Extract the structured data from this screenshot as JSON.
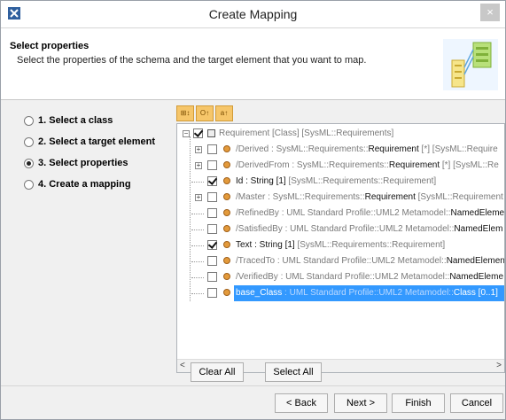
{
  "window": {
    "title": "Create Mapping",
    "close_glyph": "×",
    "app_icon": "app-icon"
  },
  "header": {
    "title": "Select properties",
    "description": "Select the properties of the schema and the target element that you want to map.",
    "art_icon": "mapping-wizard-illustration"
  },
  "steps": [
    {
      "label": "1. Select a class",
      "selected": false
    },
    {
      "label": "2. Select a target element",
      "selected": false
    },
    {
      "label": "3. Select properties",
      "selected": true
    },
    {
      "label": "4. Create a mapping",
      "selected": false
    }
  ],
  "toolbar": {
    "buttons": [
      {
        "name": "expand-all-icon",
        "glyph": "⊞↕"
      },
      {
        "name": "sort-icon",
        "glyph": "O↑"
      },
      {
        "name": "sort-alpha-icon",
        "glyph": "a↑"
      }
    ]
  },
  "tree": {
    "root": {
      "label": "Requirement [Class] [SysML::Requirements]",
      "checked": true
    },
    "items": [
      {
        "name_part": "/Derived",
        "rest_gray": " : SysML::Requirements::",
        "rest_dark": "Requirement",
        "tail": " [*] [SysML::Require",
        "checked": false,
        "expandable": true
      },
      {
        "name_part": "/DerivedFrom",
        "rest_gray": " : SysML::Requirements::",
        "rest_dark": "Requirement",
        "tail": " [*] [SysML::Re",
        "checked": false,
        "expandable": true
      },
      {
        "name_part": "Id",
        "rest_gray": "",
        "rest_dark": " : String [1]",
        "tail": " [SysML::Requirements::Requirement]",
        "checked": true,
        "expandable": false
      },
      {
        "name_part": "/Master",
        "rest_gray": " : SysML::Requirements::",
        "rest_dark": "Requirement",
        "tail": " [SysML::Requirement",
        "checked": false,
        "expandable": true
      },
      {
        "name_part": "/RefinedBy",
        "rest_gray": " : UML Standard Profile::UML2 Metamodel::",
        "rest_dark": "NamedElemen",
        "tail": "",
        "checked": false,
        "expandable": false
      },
      {
        "name_part": "/SatisfiedBy",
        "rest_gray": " : UML Standard Profile::UML2 Metamodel::",
        "rest_dark": "NamedElem",
        "tail": "",
        "checked": false,
        "expandable": false
      },
      {
        "name_part": "Text",
        "rest_gray": "",
        "rest_dark": " : String [1]",
        "tail": " [SysML::Requirements::Requirement]",
        "checked": true,
        "expandable": false
      },
      {
        "name_part": "/TracedTo",
        "rest_gray": " : UML Standard Profile::UML2 Metamodel::",
        "rest_dark": "NamedElemen",
        "tail": "",
        "checked": false,
        "expandable": false
      },
      {
        "name_part": "/VerifiedBy",
        "rest_gray": " : UML Standard Profile::UML2 Metamodel::",
        "rest_dark": "NamedEleme",
        "tail": "",
        "checked": false,
        "expandable": false
      },
      {
        "name_part": "base_Class",
        "rest_gray": " : UML Standard Profile::UML2 Metamodel::",
        "rest_dark": "Class",
        "tail": " [0..1]",
        "checked": false,
        "expandable": false,
        "selected": true
      }
    ]
  },
  "tree_buttons": {
    "clear_all": "Clear All",
    "select_all": "Select All"
  },
  "footer": {
    "back": "< Back",
    "next": "Next >",
    "finish": "Finish",
    "cancel": "Cancel"
  },
  "colors": {
    "selection": "#3399ff",
    "toolbar_button": "#f6c66a",
    "property_icon": "#e39a3b"
  }
}
